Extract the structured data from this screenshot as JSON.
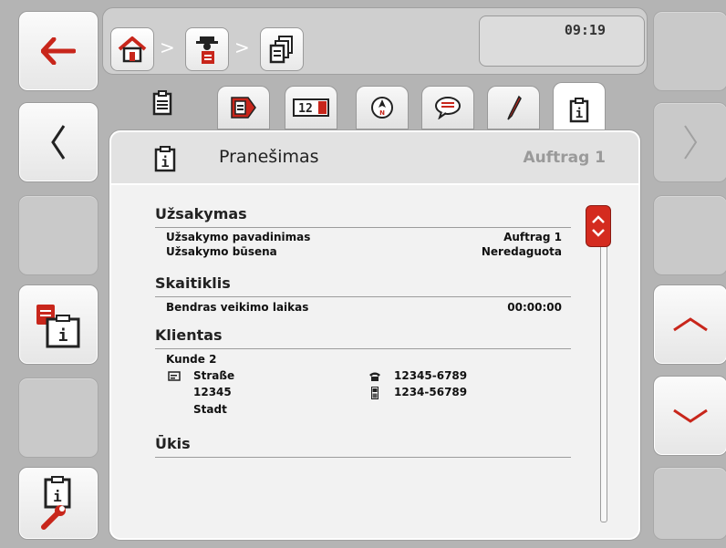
{
  "header": {
    "breadcrumb_sep": ">",
    "clock": "09:19"
  },
  "left_buttons": {
    "back": "back-arrow-icon",
    "prev": "chevron-left-icon",
    "order_info": "order-info-icon",
    "settings": "info-settings-icon"
  },
  "right_buttons": {
    "next": "chevron-right-icon",
    "scroll_up": "chevron-up-icon",
    "scroll_down": "chevron-down-icon"
  },
  "tabs": [
    "clipboard",
    "order-data",
    "counter",
    "navigation",
    "comment",
    "pen",
    "info"
  ],
  "panel": {
    "title": "Pranešimas",
    "order": "Auftrag 1"
  },
  "order": {
    "section": "Užsakymas",
    "name_label": "Užsakymo pavadinimas",
    "name_value": "Auftrag 1",
    "status_label": "Užsakymo būsena",
    "status_value": "Neredaguota"
  },
  "counter": {
    "section": "Skaitiklis",
    "total_label": "Bendras veikimo laikas",
    "total_value": "00:00:00"
  },
  "customer": {
    "section": "Klientas",
    "name": "Kunde 2",
    "street": "Straße",
    "zip": "12345",
    "city": "Stadt",
    "phone": "12345-6789",
    "mobile": "1234-56789"
  },
  "farm": {
    "section": "Ūkis"
  },
  "colors": {
    "accent": "#d42b1f",
    "frame": "#b4b4b4"
  }
}
